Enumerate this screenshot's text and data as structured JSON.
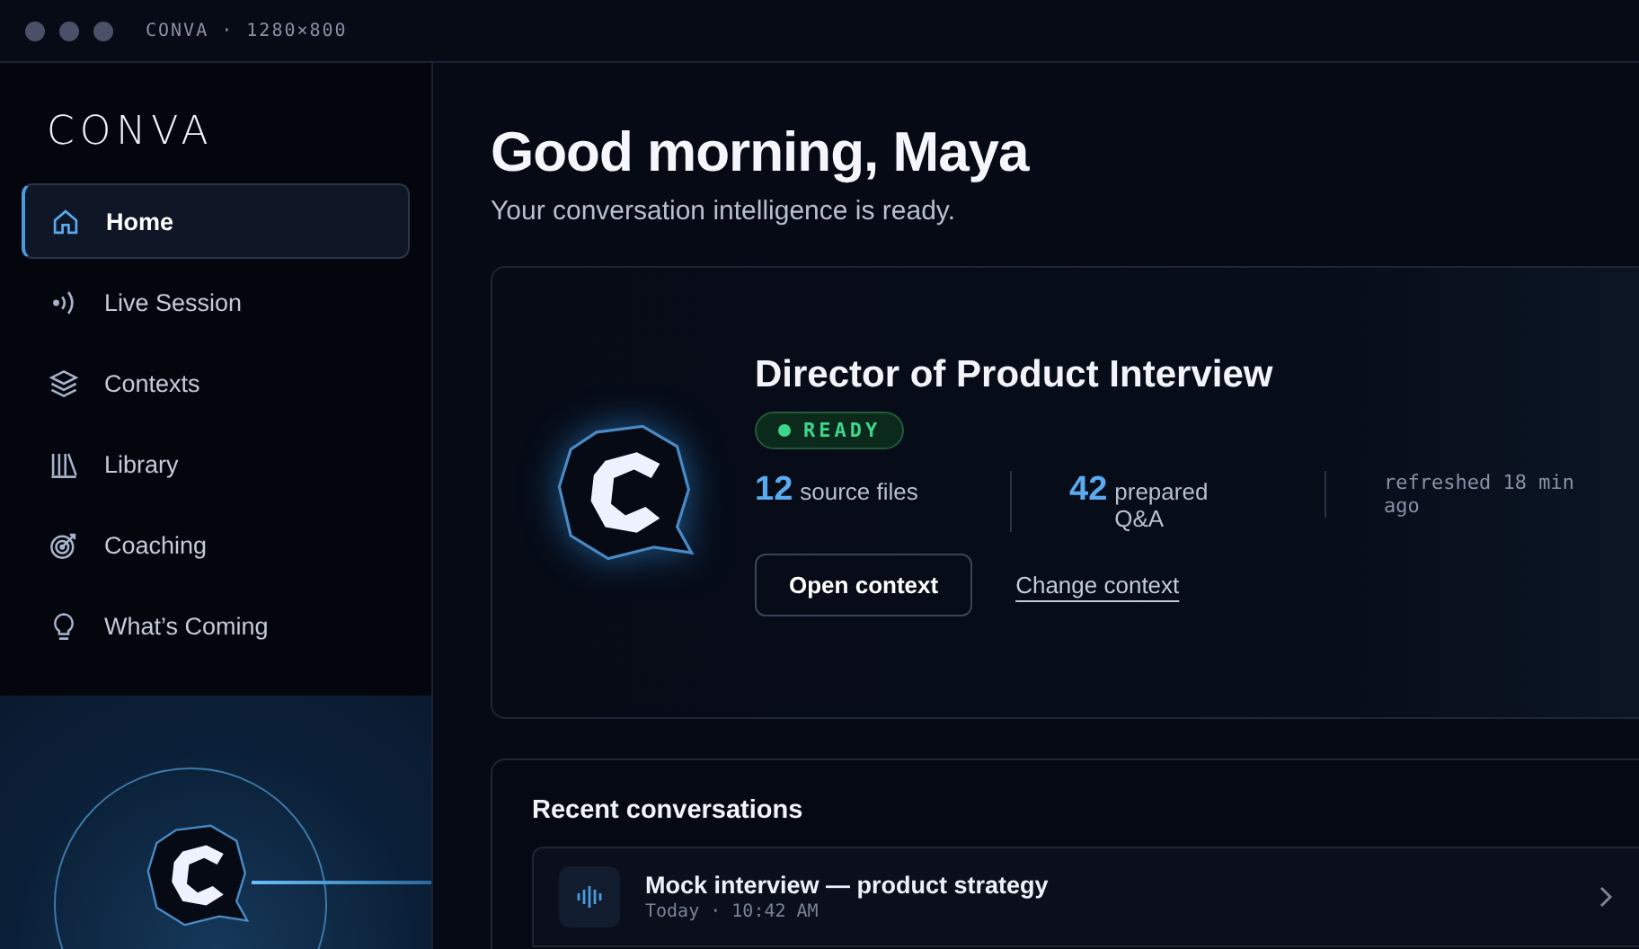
{
  "window": {
    "title": "CONVA · 1280×800"
  },
  "sidebar": {
    "brand": "CONVA",
    "items": [
      {
        "label": "Home",
        "kind": "home",
        "selected": true
      },
      {
        "label": "Live Session",
        "kind": "live",
        "selected": false
      },
      {
        "label": "Contexts",
        "kind": "layers",
        "selected": false
      },
      {
        "label": "Library",
        "kind": "library",
        "selected": false
      },
      {
        "label": "Coaching",
        "kind": "target",
        "selected": false
      },
      {
        "label": "What’s Coming",
        "kind": "bulb",
        "selected": false
      }
    ]
  },
  "greeting": {
    "title": "Good morning, Maya",
    "subtitle": "Your conversation intelligence is ready."
  },
  "context_card": {
    "title": "Director of Product Interview",
    "status": "READY",
    "stats": [
      {
        "kind": "count",
        "value": "12",
        "label": "source files"
      },
      {
        "kind": "count",
        "value": "42",
        "label": "prepared Q&A"
      },
      {
        "kind": "note",
        "label": "refreshed 18 min ago"
      }
    ],
    "primary_button": "Open context",
    "link": "Change context"
  },
  "recent": {
    "title": "Recent conversations",
    "items": [
      {
        "title": "Mock interview — product strategy",
        "meta": "Today · 10:42 AM"
      }
    ]
  }
}
